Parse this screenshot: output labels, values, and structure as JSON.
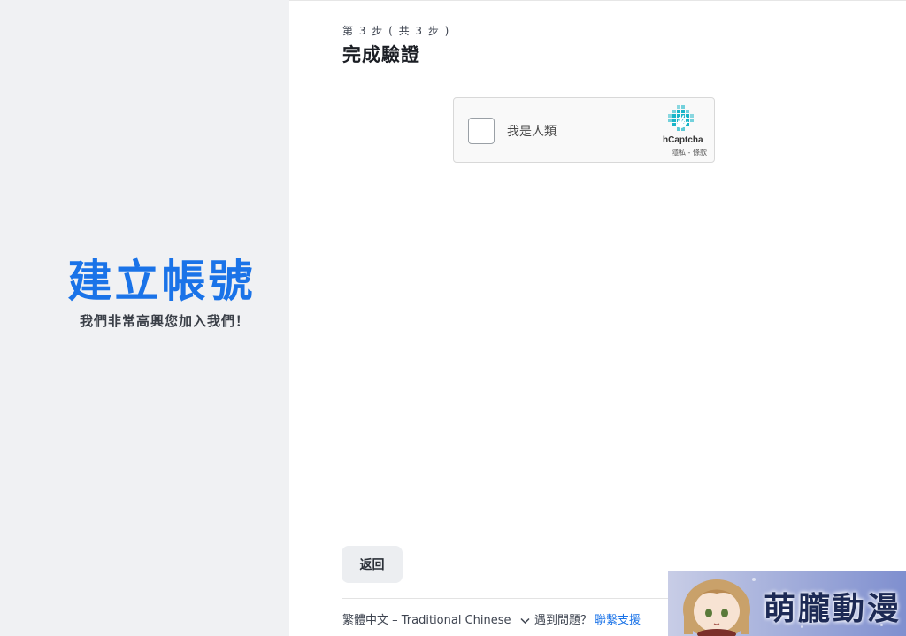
{
  "left": {
    "title": "建立帳號",
    "subtitle": "我們非常高興您加入我們！"
  },
  "main": {
    "step": "第 3 步 ( 共 3 步 )",
    "title": "完成驗證"
  },
  "captcha": {
    "label": "我是人類",
    "brand": "hCaptcha",
    "links": "隱私 - 條款"
  },
  "buttons": {
    "back": "返回"
  },
  "footer": {
    "language": "繁體中文 – Traditional Chinese",
    "help_prompt": "遇到問題？",
    "support_link": "聯繫支援"
  },
  "watermark": {
    "text": "萌朧動漫"
  },
  "colors": {
    "accent": "#1a73e8",
    "left_bg": "#f0f1f3",
    "captcha_teal": "#19b5c8"
  },
  "icons": {
    "captcha_logo": "hcaptcha-hand-icon",
    "language_chevron": "chevron-down-icon"
  }
}
